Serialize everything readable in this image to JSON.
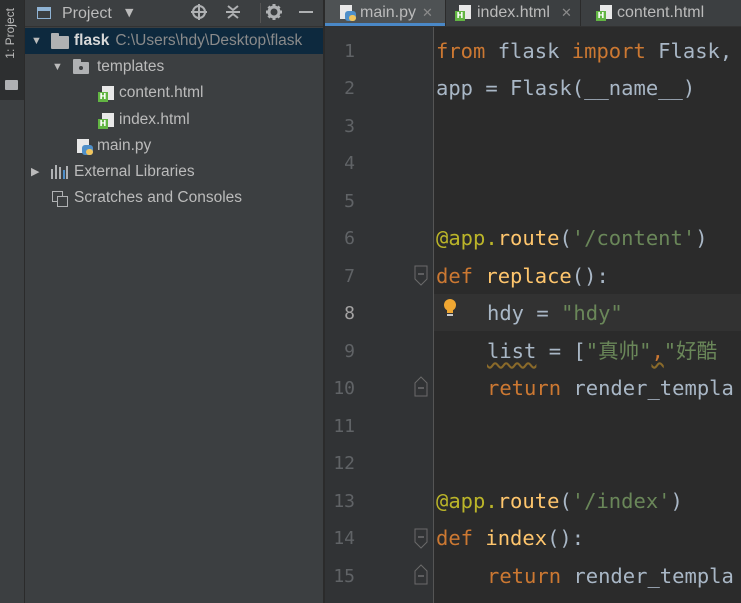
{
  "toolstrip": {
    "project_tab": "1: Project"
  },
  "project_panel": {
    "title": "Project",
    "tree": [
      {
        "name": "flask",
        "path": "C:\\Users\\hdy\\Desktop\\flask",
        "type": "folder",
        "expanded": true
      },
      {
        "name": "templates",
        "type": "folder",
        "expanded": true
      },
      {
        "name": "content.html",
        "type": "html-file"
      },
      {
        "name": "index.html",
        "type": "html-file"
      },
      {
        "name": "main.py",
        "type": "python-file"
      },
      {
        "name": "External Libraries",
        "type": "library",
        "expanded": false
      },
      {
        "name": "Scratches and Consoles",
        "type": "scratches"
      }
    ]
  },
  "editor": {
    "tabs": [
      {
        "label": "main.py",
        "active": true
      },
      {
        "label": "index.html",
        "active": false
      },
      {
        "label": "content.html",
        "active": false
      }
    ],
    "current_line": 8,
    "line_numbers": [
      "1",
      "2",
      "3",
      "4",
      "5",
      "6",
      "7",
      "8",
      "9",
      "10",
      "11",
      "12",
      "13",
      "14",
      "15"
    ],
    "code": {
      "l1": {
        "a": "from",
        "b": " flask ",
        "c": "import",
        "d": " Flask,"
      },
      "l2": {
        "a": "app = Flask(__name__)"
      },
      "l6": {
        "a": "@app.",
        "b": "route",
        "c": "(",
        "d": "'/content'",
        "e": ")"
      },
      "l7": {
        "a": "def",
        "b": " ",
        "c": "replace",
        "d": "():"
      },
      "l8": {
        "a": "hdy = ",
        "b": "\"hdy\""
      },
      "l9": {
        "a": "list",
        "b": " = [",
        "c": "\"真帅\"",
        "d": ",",
        "e": "\"好酷"
      },
      "l10": {
        "a": "return",
        "b": " render_templa"
      },
      "l13": {
        "a": "@app.",
        "b": "route",
        "c": "(",
        "d": "'/index'",
        "e": ")"
      },
      "l14": {
        "a": "def",
        "b": " ",
        "c": "index",
        "d": "():"
      },
      "l15": {
        "a": "return",
        "b": " render_templa"
      }
    }
  },
  "colors": {
    "keyword": "#cc7832",
    "decorator": "#bbb529",
    "string": "#6a8759",
    "function": "#ffc66d",
    "text": "#a9b7c6",
    "selection": "#0d293e",
    "tab_accent": "#4a88c7"
  }
}
